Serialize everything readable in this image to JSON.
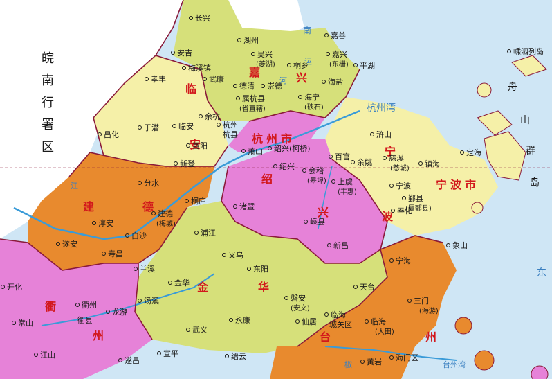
{
  "side_label": [
    "皖",
    "南",
    "行",
    "署",
    "区"
  ],
  "colors": {
    "sea": "#cfe6f5",
    "yellow_green": "#d6e07a",
    "pale_yellow": "#f5f0a8",
    "pink": "#e682d8",
    "orange": "#e88a2e",
    "region_red": "#d2181c",
    "border": "#8a1a3a",
    "river": "#3a9bd8"
  },
  "regions": [
    {
      "name": "嘉兴",
      "chars": [
        "嘉",
        "兴"
      ]
    },
    {
      "name": "临安",
      "chars": [
        "临",
        "安"
      ]
    },
    {
      "name": "杭州市",
      "chars": [
        "杭",
        "州",
        "市"
      ]
    },
    {
      "name": "建德",
      "chars": [
        "建",
        "德"
      ]
    },
    {
      "name": "绍兴",
      "chars": [
        "绍",
        "兴"
      ]
    },
    {
      "name": "宁波",
      "chars": [
        "宁",
        "波"
      ]
    },
    {
      "name": "宁波市",
      "chars": [
        "宁",
        "波",
        "市"
      ]
    },
    {
      "name": "金华",
      "chars": [
        "金",
        "华"
      ]
    },
    {
      "name": "衢州",
      "chars": [
        "衢",
        "州"
      ]
    },
    {
      "name": "台州",
      "chars": [
        "台",
        "州"
      ]
    }
  ],
  "places": {
    "changxing": "长兴",
    "huzhou": "湖州",
    "jiashan": "嘉善",
    "wuxing": "吴兴",
    "wuxing_sub": "(菱湖)",
    "tongxiang": "桐乡",
    "jiaxing": "嘉兴",
    "jiaxing_sub": "(东栅)",
    "pinghu": "平湖",
    "anji": "安吉",
    "meixi": "梅溪镇",
    "xiaofeng": "孝丰",
    "wukang": "武康",
    "deqing": "德清",
    "chongde": "崇德",
    "haiyan": "海盐",
    "haining": "海宁",
    "haining_sub": "(硖石)",
    "shuhangxian": "属杭县",
    "shuhangxian_sub": "(省直辖)",
    "yuhang": "余杭",
    "hangzhou": "杭州",
    "hangxian": "杭县",
    "changhua": "昌化",
    "yuqian": "于潜",
    "lin_an": "临安",
    "fuyang": "富阳",
    "xiaoshan": "萧山",
    "shaoxing_kq": "绍兴(柯桥)",
    "baiguan": "百官",
    "yuyao": "余姚",
    "xinshan": "浒山",
    "cixi": "慈溪",
    "cixi_sub": "(慈城)",
    "zhenhai": "镇海",
    "xindeng": "新登",
    "fenshui": "分水",
    "tonglu": "桐庐",
    "jiande": "建德",
    "jiande_sub": "(梅城)",
    "chun_an": "淳安",
    "suian": "遂安",
    "baisha": "白沙",
    "shouchang": "寿昌",
    "shaoxing": "绍兴",
    "kuaiji": "会稽",
    "kuaiji_sub": "(皋埠)",
    "shangyu": "上虞",
    "shangyu_sub": "(丰惠)",
    "ningbo": "宁波",
    "yinxian": "鄞县",
    "yinxian_sub": "(属鄞县)",
    "fenghua": "奉化",
    "zhuji": "诸暨",
    "shengxian": "嵊县",
    "xinchang": "新昌",
    "xiangshan": "象山",
    "pujiang": "浦江",
    "yiwu": "义乌",
    "dongyang": "东阳",
    "lanxi": "兰溪",
    "jinhua": "金华",
    "tangxi": "汤溪",
    "kaihua": "开化",
    "quzhou": "衢州",
    "quxian": "衢县",
    "longyou": "龙游",
    "wuyi": "武义",
    "yongkang": "永康",
    "pan_an": "磐安",
    "pan_an_sub": "(安文)",
    "ninghai": "宁海",
    "tiantai": "天台",
    "sanmen": "三门",
    "sanmen_sub": "(海游)",
    "xianju": "仙居",
    "linhai": "临海",
    "chengguan": "城关区",
    "linhai2": "临海",
    "linhai2_sub": "(大田)",
    "haimen": "海门区",
    "huangyan": "黄岩",
    "changshan": "常山",
    "jiangshan": "江山",
    "suichang": "遂昌",
    "xuanping": "宣平",
    "jinyun": "缙云",
    "dinghai": "定海",
    "shengsi": "嵊泗列岛"
  },
  "islands": [
    "舟",
    "山",
    "群",
    "岛"
  ],
  "water": {
    "hangzhou_bay": "杭州湾",
    "nan": "南",
    "yunhe": "运",
    "he": "河",
    "jiang": "江",
    "dong": "东",
    "jiao": "椒",
    "taizhou_wan": "台州湾"
  }
}
